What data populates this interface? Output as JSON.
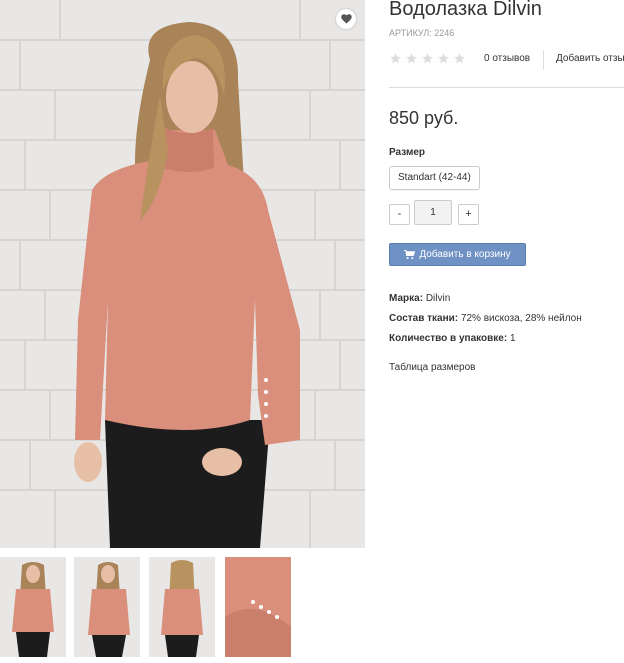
{
  "product": {
    "title": "Водолазка Dilvin",
    "sku": "АРТИКУЛ: 2246",
    "reviews_count": "0 отзывов",
    "add_review": "Добавить отзыв",
    "price": "850 руб.",
    "size_label": "Размер",
    "size_option": "Standart (42-44)",
    "qty_minus": "-",
    "qty_value": "1",
    "qty_plus": "+",
    "add_to_cart": "Добавить в корзину",
    "rating_stars": 0,
    "attributes": [
      {
        "label": "Марка:",
        "value": "Dilvin"
      },
      {
        "label": "Состав ткани:",
        "value": "72% вискоза, 28% нейлон"
      },
      {
        "label": "Количество в упаковке:",
        "value": "1"
      }
    ],
    "size_table": "Таблица размеров"
  },
  "colors": {
    "accent_button": "#6f91c4",
    "sweater": "#d98f7c",
    "wall": "#e7e6e4"
  },
  "icons": {
    "wishlist": "heart-icon",
    "cart": "cart-icon",
    "star": "star-icon"
  }
}
